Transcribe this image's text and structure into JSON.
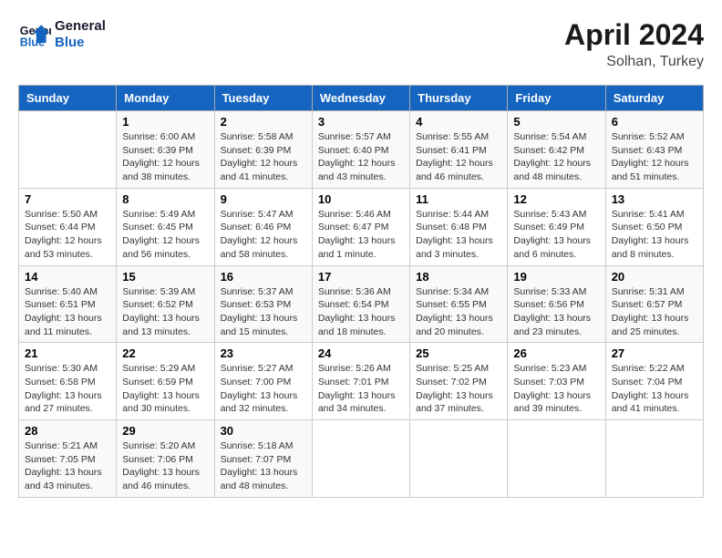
{
  "header": {
    "logo_line1": "General",
    "logo_line2": "Blue",
    "title": "April 2024",
    "subtitle": "Solhan, Turkey"
  },
  "weekdays": [
    "Sunday",
    "Monday",
    "Tuesday",
    "Wednesday",
    "Thursday",
    "Friday",
    "Saturday"
  ],
  "weeks": [
    [
      {
        "day": "",
        "sunrise": "",
        "sunset": "",
        "daylight": ""
      },
      {
        "day": "1",
        "sunrise": "Sunrise: 6:00 AM",
        "sunset": "Sunset: 6:39 PM",
        "daylight": "Daylight: 12 hours and 38 minutes."
      },
      {
        "day": "2",
        "sunrise": "Sunrise: 5:58 AM",
        "sunset": "Sunset: 6:39 PM",
        "daylight": "Daylight: 12 hours and 41 minutes."
      },
      {
        "day": "3",
        "sunrise": "Sunrise: 5:57 AM",
        "sunset": "Sunset: 6:40 PM",
        "daylight": "Daylight: 12 hours and 43 minutes."
      },
      {
        "day": "4",
        "sunrise": "Sunrise: 5:55 AM",
        "sunset": "Sunset: 6:41 PM",
        "daylight": "Daylight: 12 hours and 46 minutes."
      },
      {
        "day": "5",
        "sunrise": "Sunrise: 5:54 AM",
        "sunset": "Sunset: 6:42 PM",
        "daylight": "Daylight: 12 hours and 48 minutes."
      },
      {
        "day": "6",
        "sunrise": "Sunrise: 5:52 AM",
        "sunset": "Sunset: 6:43 PM",
        "daylight": "Daylight: 12 hours and 51 minutes."
      }
    ],
    [
      {
        "day": "7",
        "sunrise": "Sunrise: 5:50 AM",
        "sunset": "Sunset: 6:44 PM",
        "daylight": "Daylight: 12 hours and 53 minutes."
      },
      {
        "day": "8",
        "sunrise": "Sunrise: 5:49 AM",
        "sunset": "Sunset: 6:45 PM",
        "daylight": "Daylight: 12 hours and 56 minutes."
      },
      {
        "day": "9",
        "sunrise": "Sunrise: 5:47 AM",
        "sunset": "Sunset: 6:46 PM",
        "daylight": "Daylight: 12 hours and 58 minutes."
      },
      {
        "day": "10",
        "sunrise": "Sunrise: 5:46 AM",
        "sunset": "Sunset: 6:47 PM",
        "daylight": "Daylight: 13 hours and 1 minute."
      },
      {
        "day": "11",
        "sunrise": "Sunrise: 5:44 AM",
        "sunset": "Sunset: 6:48 PM",
        "daylight": "Daylight: 13 hours and 3 minutes."
      },
      {
        "day": "12",
        "sunrise": "Sunrise: 5:43 AM",
        "sunset": "Sunset: 6:49 PM",
        "daylight": "Daylight: 13 hours and 6 minutes."
      },
      {
        "day": "13",
        "sunrise": "Sunrise: 5:41 AM",
        "sunset": "Sunset: 6:50 PM",
        "daylight": "Daylight: 13 hours and 8 minutes."
      }
    ],
    [
      {
        "day": "14",
        "sunrise": "Sunrise: 5:40 AM",
        "sunset": "Sunset: 6:51 PM",
        "daylight": "Daylight: 13 hours and 11 minutes."
      },
      {
        "day": "15",
        "sunrise": "Sunrise: 5:39 AM",
        "sunset": "Sunset: 6:52 PM",
        "daylight": "Daylight: 13 hours and 13 minutes."
      },
      {
        "day": "16",
        "sunrise": "Sunrise: 5:37 AM",
        "sunset": "Sunset: 6:53 PM",
        "daylight": "Daylight: 13 hours and 15 minutes."
      },
      {
        "day": "17",
        "sunrise": "Sunrise: 5:36 AM",
        "sunset": "Sunset: 6:54 PM",
        "daylight": "Daylight: 13 hours and 18 minutes."
      },
      {
        "day": "18",
        "sunrise": "Sunrise: 5:34 AM",
        "sunset": "Sunset: 6:55 PM",
        "daylight": "Daylight: 13 hours and 20 minutes."
      },
      {
        "day": "19",
        "sunrise": "Sunrise: 5:33 AM",
        "sunset": "Sunset: 6:56 PM",
        "daylight": "Daylight: 13 hours and 23 minutes."
      },
      {
        "day": "20",
        "sunrise": "Sunrise: 5:31 AM",
        "sunset": "Sunset: 6:57 PM",
        "daylight": "Daylight: 13 hours and 25 minutes."
      }
    ],
    [
      {
        "day": "21",
        "sunrise": "Sunrise: 5:30 AM",
        "sunset": "Sunset: 6:58 PM",
        "daylight": "Daylight: 13 hours and 27 minutes."
      },
      {
        "day": "22",
        "sunrise": "Sunrise: 5:29 AM",
        "sunset": "Sunset: 6:59 PM",
        "daylight": "Daylight: 13 hours and 30 minutes."
      },
      {
        "day": "23",
        "sunrise": "Sunrise: 5:27 AM",
        "sunset": "Sunset: 7:00 PM",
        "daylight": "Daylight: 13 hours and 32 minutes."
      },
      {
        "day": "24",
        "sunrise": "Sunrise: 5:26 AM",
        "sunset": "Sunset: 7:01 PM",
        "daylight": "Daylight: 13 hours and 34 minutes."
      },
      {
        "day": "25",
        "sunrise": "Sunrise: 5:25 AM",
        "sunset": "Sunset: 7:02 PM",
        "daylight": "Daylight: 13 hours and 37 minutes."
      },
      {
        "day": "26",
        "sunrise": "Sunrise: 5:23 AM",
        "sunset": "Sunset: 7:03 PM",
        "daylight": "Daylight: 13 hours and 39 minutes."
      },
      {
        "day": "27",
        "sunrise": "Sunrise: 5:22 AM",
        "sunset": "Sunset: 7:04 PM",
        "daylight": "Daylight: 13 hours and 41 minutes."
      }
    ],
    [
      {
        "day": "28",
        "sunrise": "Sunrise: 5:21 AM",
        "sunset": "Sunset: 7:05 PM",
        "daylight": "Daylight: 13 hours and 43 minutes."
      },
      {
        "day": "29",
        "sunrise": "Sunrise: 5:20 AM",
        "sunset": "Sunset: 7:06 PM",
        "daylight": "Daylight: 13 hours and 46 minutes."
      },
      {
        "day": "30",
        "sunrise": "Sunrise: 5:18 AM",
        "sunset": "Sunset: 7:07 PM",
        "daylight": "Daylight: 13 hours and 48 minutes."
      },
      {
        "day": "",
        "sunrise": "",
        "sunset": "",
        "daylight": ""
      },
      {
        "day": "",
        "sunrise": "",
        "sunset": "",
        "daylight": ""
      },
      {
        "day": "",
        "sunrise": "",
        "sunset": "",
        "daylight": ""
      },
      {
        "day": "",
        "sunrise": "",
        "sunset": "",
        "daylight": ""
      }
    ]
  ]
}
